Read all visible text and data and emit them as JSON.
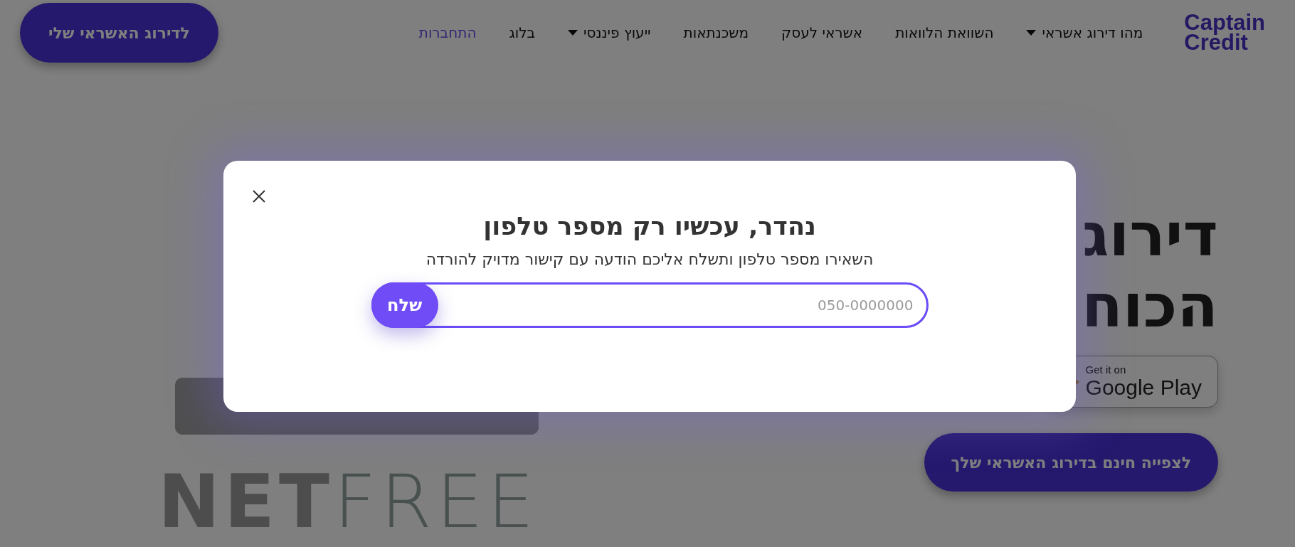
{
  "header": {
    "logo": [
      "Captain",
      "Credit"
    ],
    "nav": [
      {
        "label": "מהו דירוג אשראי",
        "dropdown": true,
        "kind": "link"
      },
      {
        "label": "השוואת הלוואות",
        "dropdown": false,
        "kind": "link"
      },
      {
        "label": "אשראי לעסק",
        "dropdown": false,
        "kind": "link"
      },
      {
        "label": "משכנתאות",
        "dropdown": false,
        "kind": "link"
      },
      {
        "label": "ייעוץ פיננסי",
        "dropdown": true,
        "kind": "link"
      },
      {
        "label": "בלוג",
        "dropdown": false,
        "kind": "link"
      },
      {
        "label": "התחברות",
        "dropdown": false,
        "kind": "login"
      }
    ],
    "cta": "לדירוג האשראי שלי"
  },
  "hero": {
    "title_lines": [
      "דירוג",
      "הכוח"
    ],
    "store_badge": {
      "small": "Get it on",
      "large": "Google Play"
    },
    "cta": "לצפייה חינם בדירוג האשראי שלך"
  },
  "netfree": {
    "bold": "NET",
    "light": "FREE"
  },
  "modal": {
    "title": "נהדר, עכשיו רק מספר טלפון",
    "subtitle": "השאירו מספר טלפון ותשלח אליכם הודעה עם קישור מדויק להורדה",
    "phone_field": {
      "placeholder": "050-0000000"
    },
    "submit": "שלח"
  }
}
